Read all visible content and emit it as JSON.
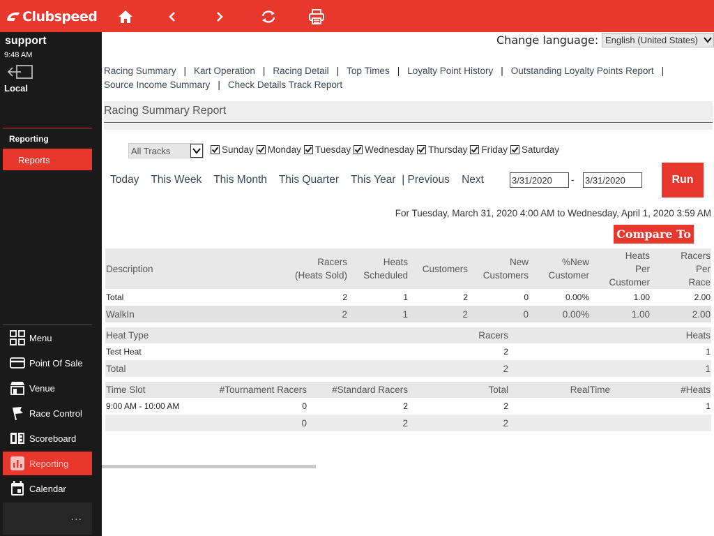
{
  "app": {
    "brand": "Clubspeed",
    "accent": "#e8382d"
  },
  "toolbar": {
    "icons": [
      "home-icon",
      "back-icon",
      "forward-icon",
      "refresh-icon",
      "print-icon"
    ]
  },
  "sidebar": {
    "user": "support",
    "time": "9:48 AM",
    "location": "Local",
    "section_heading": "Reporting",
    "section_item": "Reports",
    "nav": [
      {
        "label": "Menu",
        "icon": "grid-icon"
      },
      {
        "label": "Point Of Sale",
        "icon": "card-icon"
      },
      {
        "label": "Venue",
        "icon": "venue-icon"
      },
      {
        "label": "Race Control",
        "icon": "flag-icon"
      },
      {
        "label": "Scoreboard",
        "icon": "scoreboard-icon"
      },
      {
        "label": "Reporting",
        "icon": "bar-chart-icon"
      },
      {
        "label": "Calendar",
        "icon": "calendar-icon"
      }
    ],
    "more": "..."
  },
  "language": {
    "label": "Change language:",
    "value": "English (United States)"
  },
  "report_links": [
    "Racing Summary",
    "Kart Operation",
    "Racing Detail",
    "Top Times",
    "Loyalty Point History",
    "Outstanding Loyalty Points Report",
    "Source Income Summary",
    "Check Details Track Report"
  ],
  "report_title": "Racing Summary Report",
  "filters": {
    "track": "All Tracks",
    "days": [
      "Sunday",
      "Monday",
      "Tuesday",
      "Wednesday",
      "Thursday",
      "Friday",
      "Saturday"
    ],
    "periods": [
      "Today",
      "This Week",
      "This Month",
      "This Quarter",
      "This Year",
      "| Previous",
      "Next"
    ],
    "date_from": "3/31/2020",
    "date_sep": "-",
    "date_to": "3/31/2020",
    "run": "Run"
  },
  "range_text": "For Tuesday, March 31, 2020 4:00 AM to Wednesday, April 1, 2020 3:59 AM",
  "compare_label": "Compare To",
  "summary": {
    "headers": [
      {
        "l1": "",
        "l2": "Description",
        "l3": ""
      },
      {
        "l1": "Racers",
        "l2": "(Heats Sold)",
        "l3": ""
      },
      {
        "l1": "Heats",
        "l2": "Scheduled",
        "l3": ""
      },
      {
        "l1": "",
        "l2": "Customers",
        "l3": ""
      },
      {
        "l1": "New",
        "l2": "Customers",
        "l3": ""
      },
      {
        "l1": "%New",
        "l2": "Customer",
        "l3": ""
      },
      {
        "l1": "Heats",
        "l2": "Per",
        "l3": "Customer"
      },
      {
        "l1": "Racers",
        "l2": "Per",
        "l3": "Race"
      }
    ],
    "rows": [
      [
        "Total",
        "2",
        "1",
        "2",
        "0",
        "0.00%",
        "1.00",
        "2.00"
      ],
      [
        "WalkIn",
        "2",
        "1",
        "2",
        "0",
        "0.00%",
        "1.00",
        "2.00"
      ]
    ]
  },
  "heat_types": {
    "headers": [
      "Heat Type",
      "Racers",
      "Heats"
    ],
    "rows": [
      [
        "Test Heat",
        "2",
        "1"
      ],
      [
        "Total",
        "2",
        "1"
      ]
    ]
  },
  "time_slots": {
    "headers": [
      "Time Slot",
      "#Tournament Racers",
      "#Standard Racers",
      "Total",
      "RealTime",
      "#Heats"
    ],
    "rows": [
      [
        "9:00 AM - 10:00 AM",
        "0",
        "2",
        "2",
        "",
        "1"
      ],
      [
        "",
        "0",
        "2",
        "2",
        "",
        ""
      ]
    ]
  }
}
